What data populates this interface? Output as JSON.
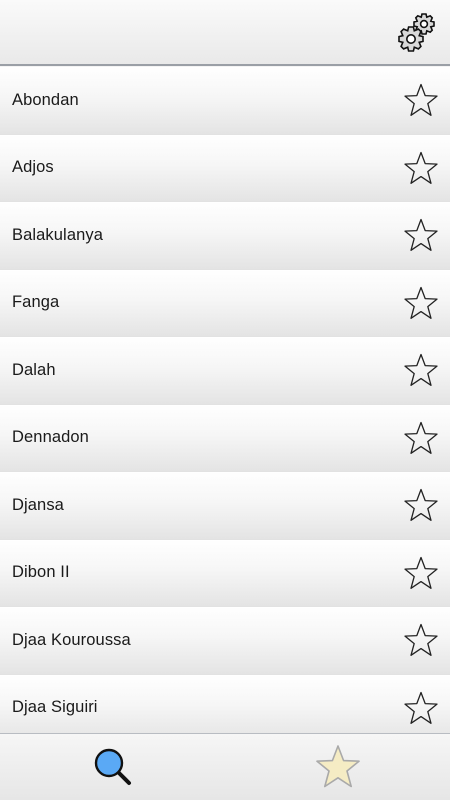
{
  "header": {
    "settings_icon": "gears-icon"
  },
  "list": {
    "items": [
      {
        "label": "Abondan",
        "favorite": false
      },
      {
        "label": "Adjos",
        "favorite": false
      },
      {
        "label": "Balakulanya",
        "favorite": false
      },
      {
        "label": "Fanga",
        "favorite": false
      },
      {
        "label": "Dalah",
        "favorite": false
      },
      {
        "label": "Dennadon",
        "favorite": false
      },
      {
        "label": "Djansa",
        "favorite": false
      },
      {
        "label": "Dibon II",
        "favorite": false
      },
      {
        "label": "Djaa Kouroussa",
        "favorite": false
      },
      {
        "label": "Djaa Siguiri",
        "favorite": false
      }
    ],
    "star_icon": "star-outline-icon"
  },
  "tabbar": {
    "tabs": [
      {
        "icon": "search-icon",
        "color": "#5aa9f5",
        "active": true
      },
      {
        "icon": "star-icon",
        "color": "#f5ecc4",
        "active": false
      }
    ]
  }
}
